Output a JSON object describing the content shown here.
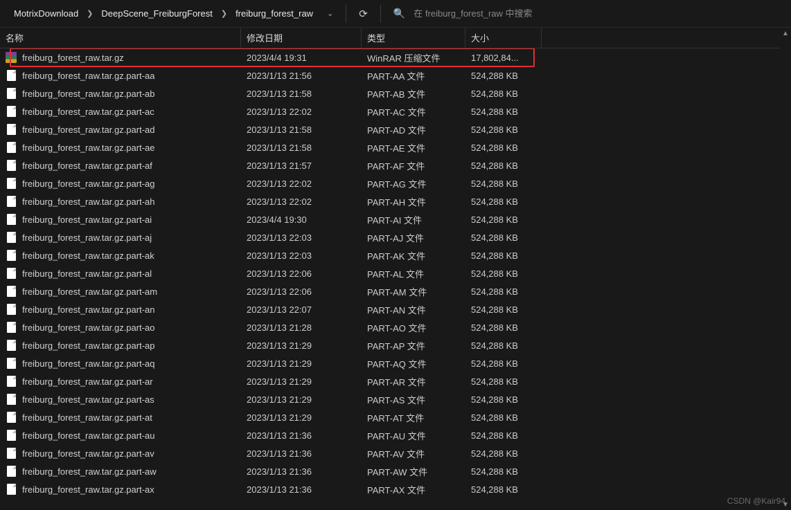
{
  "breadcrumb": {
    "items": [
      "MotrixDownload",
      "DeepScene_FreiburgForest",
      "freiburg_forest_raw"
    ]
  },
  "search": {
    "placeholder": "在 freiburg_forest_raw 中搜索"
  },
  "columns": {
    "name": "名称",
    "date": "修改日期",
    "type": "类型",
    "size": "大小"
  },
  "files": [
    {
      "icon": "rar",
      "name": "freiburg_forest_raw.tar.gz",
      "date": "2023/4/4 19:31",
      "type": "WinRAR 压缩文件",
      "size": "17,802,84...",
      "highlight": true
    },
    {
      "icon": "file",
      "name": "freiburg_forest_raw.tar.gz.part-aa",
      "date": "2023/1/13 21:56",
      "type": "PART-AA 文件",
      "size": "524,288 KB"
    },
    {
      "icon": "file",
      "name": "freiburg_forest_raw.tar.gz.part-ab",
      "date": "2023/1/13 21:58",
      "type": "PART-AB 文件",
      "size": "524,288 KB"
    },
    {
      "icon": "file",
      "name": "freiburg_forest_raw.tar.gz.part-ac",
      "date": "2023/1/13 22:02",
      "type": "PART-AC 文件",
      "size": "524,288 KB"
    },
    {
      "icon": "file",
      "name": "freiburg_forest_raw.tar.gz.part-ad",
      "date": "2023/1/13 21:58",
      "type": "PART-AD 文件",
      "size": "524,288 KB"
    },
    {
      "icon": "file",
      "name": "freiburg_forest_raw.tar.gz.part-ae",
      "date": "2023/1/13 21:58",
      "type": "PART-AE 文件",
      "size": "524,288 KB"
    },
    {
      "icon": "file",
      "name": "freiburg_forest_raw.tar.gz.part-af",
      "date": "2023/1/13 21:57",
      "type": "PART-AF 文件",
      "size": "524,288 KB"
    },
    {
      "icon": "file",
      "name": "freiburg_forest_raw.tar.gz.part-ag",
      "date": "2023/1/13 22:02",
      "type": "PART-AG 文件",
      "size": "524,288 KB"
    },
    {
      "icon": "file",
      "name": "freiburg_forest_raw.tar.gz.part-ah",
      "date": "2023/1/13 22:02",
      "type": "PART-AH 文件",
      "size": "524,288 KB"
    },
    {
      "icon": "file",
      "name": "freiburg_forest_raw.tar.gz.part-ai",
      "date": "2023/4/4 19:30",
      "type": "PART-AI 文件",
      "size": "524,288 KB"
    },
    {
      "icon": "file",
      "name": "freiburg_forest_raw.tar.gz.part-aj",
      "date": "2023/1/13 22:03",
      "type": "PART-AJ 文件",
      "size": "524,288 KB"
    },
    {
      "icon": "file",
      "name": "freiburg_forest_raw.tar.gz.part-ak",
      "date": "2023/1/13 22:03",
      "type": "PART-AK 文件",
      "size": "524,288 KB"
    },
    {
      "icon": "file",
      "name": "freiburg_forest_raw.tar.gz.part-al",
      "date": "2023/1/13 22:06",
      "type": "PART-AL 文件",
      "size": "524,288 KB"
    },
    {
      "icon": "file",
      "name": "freiburg_forest_raw.tar.gz.part-am",
      "date": "2023/1/13 22:06",
      "type": "PART-AM 文件",
      "size": "524,288 KB"
    },
    {
      "icon": "file",
      "name": "freiburg_forest_raw.tar.gz.part-an",
      "date": "2023/1/13 22:07",
      "type": "PART-AN 文件",
      "size": "524,288 KB"
    },
    {
      "icon": "file",
      "name": "freiburg_forest_raw.tar.gz.part-ao",
      "date": "2023/1/13 21:28",
      "type": "PART-AO 文件",
      "size": "524,288 KB"
    },
    {
      "icon": "file",
      "name": "freiburg_forest_raw.tar.gz.part-ap",
      "date": "2023/1/13 21:29",
      "type": "PART-AP 文件",
      "size": "524,288 KB"
    },
    {
      "icon": "file",
      "name": "freiburg_forest_raw.tar.gz.part-aq",
      "date": "2023/1/13 21:29",
      "type": "PART-AQ 文件",
      "size": "524,288 KB"
    },
    {
      "icon": "file",
      "name": "freiburg_forest_raw.tar.gz.part-ar",
      "date": "2023/1/13 21:29",
      "type": "PART-AR 文件",
      "size": "524,288 KB"
    },
    {
      "icon": "file",
      "name": "freiburg_forest_raw.tar.gz.part-as",
      "date": "2023/1/13 21:29",
      "type": "PART-AS 文件",
      "size": "524,288 KB"
    },
    {
      "icon": "file",
      "name": "freiburg_forest_raw.tar.gz.part-at",
      "date": "2023/1/13 21:29",
      "type": "PART-AT 文件",
      "size": "524,288 KB"
    },
    {
      "icon": "file",
      "name": "freiburg_forest_raw.tar.gz.part-au",
      "date": "2023/1/13 21:36",
      "type": "PART-AU 文件",
      "size": "524,288 KB"
    },
    {
      "icon": "file",
      "name": "freiburg_forest_raw.tar.gz.part-av",
      "date": "2023/1/13 21:36",
      "type": "PART-AV 文件",
      "size": "524,288 KB"
    },
    {
      "icon": "file",
      "name": "freiburg_forest_raw.tar.gz.part-aw",
      "date": "2023/1/13 21:36",
      "type": "PART-AW 文件",
      "size": "524,288 KB"
    },
    {
      "icon": "file",
      "name": "freiburg_forest_raw.tar.gz.part-ax",
      "date": "2023/1/13 21:36",
      "type": "PART-AX 文件",
      "size": "524,288 KB"
    }
  ],
  "watermark": "CSDN @Kair94"
}
